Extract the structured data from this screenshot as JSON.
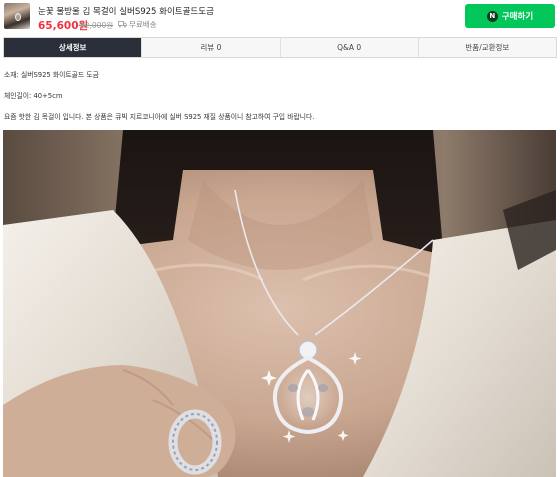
{
  "product": {
    "title": "눈꽃 물방울 김 목걸이 실버S925 화이트골드도금",
    "price": "65,600원",
    "original_price": "82,000원",
    "shipping": "무료배송",
    "buy_label": "구매하기",
    "naver_badge": "N"
  },
  "tabs": [
    {
      "label": "상세정보",
      "active": true
    },
    {
      "label": "리뷰 0"
    },
    {
      "label": "Q&A 0"
    },
    {
      "label": "반품/교환정보"
    }
  ],
  "details": {
    "material": "소재: 실버S925 화이트골드 도금",
    "chain_length": "체인길이: 40+5cm",
    "description": "요즘 핫한 김 목걸이 입니다. 본 상품은 큐빅 지르코니아에 실버 S925 재질 상품이니 참고하여 구입 바랍니다."
  },
  "colors": {
    "price": "#f2333f",
    "buy_button": "#03c75a",
    "active_tab": "#2a2f3a"
  }
}
